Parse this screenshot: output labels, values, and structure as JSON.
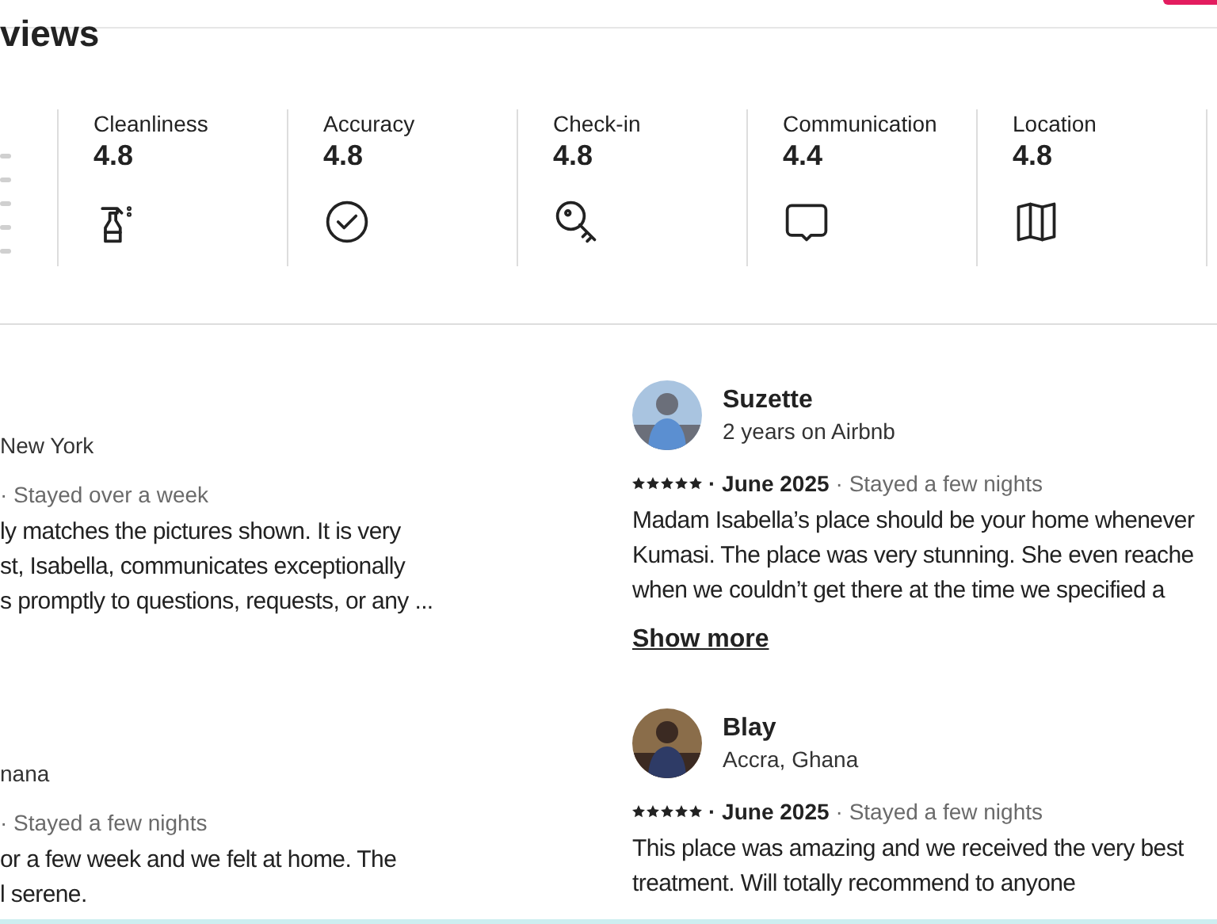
{
  "heading": "views",
  "categories": [
    {
      "label": "Cleanliness",
      "value": "4.8",
      "kind": "spray"
    },
    {
      "label": "Accuracy",
      "value": "4.8",
      "kind": "check"
    },
    {
      "label": "Check-in",
      "value": "4.8",
      "kind": "key"
    },
    {
      "label": "Communication",
      "value": "4.4",
      "kind": "chat"
    },
    {
      "label": "Location",
      "value": "4.8",
      "kind": "map"
    }
  ],
  "reviews_left": [
    {
      "subtitle": "New York",
      "stay": "· Stayed over a week",
      "body": [
        "ly matches the pictures shown. It is very",
        "st, Isabella, communicates exceptionally",
        "s promptly to questions, requests, or any ..."
      ]
    },
    {
      "subtitle": "nana",
      "stay": "· Stayed a few nights",
      "body": [
        "or a few week and we felt at home. The",
        "l serene."
      ]
    }
  ],
  "reviews_right": [
    {
      "name": "Suzette",
      "subtitle": "2 years on Airbnb",
      "stars": 5,
      "date": "· June 2025",
      "stay": "· Stayed a few nights",
      "body": [
        "Madam Isabella’s place should be your home whenever",
        "Kumasi. The place was very stunning. She even reache",
        "when we couldn’t get there at the time we specified a"
      ],
      "show_more": "Show more"
    },
    {
      "name": "Blay",
      "subtitle": "Accra, Ghana",
      "stars": 5,
      "date": "· June 2025",
      "stay": "· Stayed a few nights",
      "body": [
        "This place was amazing and we received the very best",
        "treatment. Will totally recommend to anyone"
      ]
    }
  ]
}
